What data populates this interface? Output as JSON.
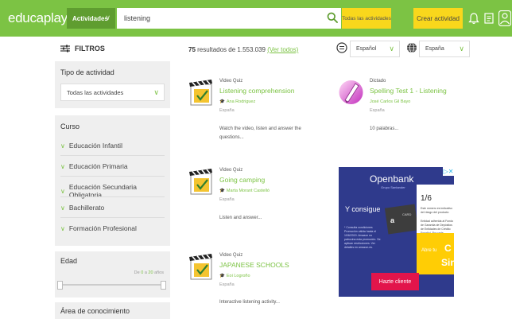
{
  "header": {
    "logo": "educaplay",
    "activities_button": "Actividades",
    "search_value": "listening",
    "all_activities_button": "Todas las actividades",
    "create_button": "Crear actividad"
  },
  "sidebar": {
    "filters_title": "FILTROS",
    "activity_type": {
      "title": "Tipo de actividad",
      "selected": "Todas las actividades"
    },
    "course": {
      "title": "Curso",
      "items": [
        {
          "label": "Educación Infantil"
        },
        {
          "label": "Educación Primaria"
        },
        {
          "label": "Educación Secundaria Obligatoria"
        },
        {
          "label": "Bachillerato"
        },
        {
          "label": "Formación Profesional"
        }
      ]
    },
    "age": {
      "title": "Edad",
      "range_prefix": "De",
      "min": "0",
      "range_mid": "a",
      "max": "20",
      "range_suffix": "años"
    },
    "knowledge_area": {
      "title": "Área de conocimiento"
    }
  },
  "results": {
    "count": "75",
    "count_text": "resultados de 1.553.039",
    "see_all": "(Ver todos)",
    "language": "Español",
    "country": "España"
  },
  "cards": [
    {
      "type": "Video Quiz",
      "title": "Listening comprehension",
      "author": "Ana Rodriguez",
      "country": "España",
      "description": "Watch the video, listen and answer the questions..."
    },
    {
      "type": "Dictado",
      "title": "Spelling Test 1 - Listening",
      "author": "José Carlos Gil Bayo",
      "country": "España",
      "description": "10 palabras..."
    },
    {
      "type": "Video Quiz",
      "title": "Going camping",
      "author": "Marta Morant Castelló",
      "country": "España",
      "description": "Listen and answer..."
    },
    {
      "type": "Video Quiz",
      "title": "JAPANESE SCHOOLS",
      "author": "Eoi Logroño",
      "country": "España",
      "description": "Interactive listening activity..."
    }
  ],
  "ad": {
    "brand": "Openbank",
    "brand_sub": "Grupo Santander",
    "headline": "Y consigue",
    "fine_print": "* Consulta condiciones Promoción válida hasta el 10/6/2019. Amazon no patrocina esta promoción. Se aplican restricciones. Ver detalles en amazon.es.",
    "card_letter": "a",
    "card_text": "CARD",
    "fraction": "1/6",
    "note1": "Este número es indicativo del riesgo del producto",
    "note2": "Entidad adherida al Fondo de Garantía de Depósitos de Entidades de Crédito Español. Por cada depositante hasta 100.000€ por cliente",
    "abre": "Abre tu",
    "big1": "C",
    "big2": "Sin",
    "cta": "Hazte cliente",
    "close": "▷✕"
  },
  "colors": {
    "brand_green": "#7cc344",
    "dark_green": "#5f9d30",
    "yellow": "#f9d71c",
    "ad_blue": "#2f3a8c",
    "ad_red": "#e2154b"
  }
}
